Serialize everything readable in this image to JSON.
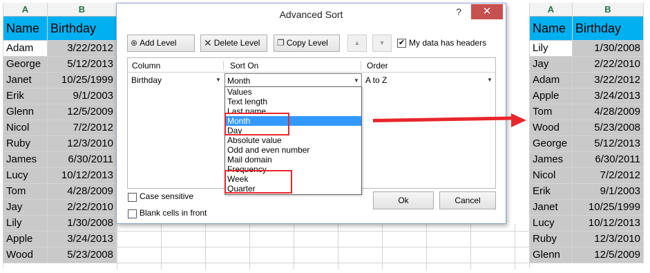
{
  "left_sheet": {
    "col_headers": [
      "A",
      "B"
    ],
    "header_row": [
      "Name",
      "Birthday"
    ],
    "rows": [
      [
        "Adam",
        "3/22/2012"
      ],
      [
        "George",
        "5/12/2013"
      ],
      [
        "Janet",
        "10/25/1999"
      ],
      [
        "Erik",
        "9/1/2003"
      ],
      [
        "Glenn",
        "12/5/2009"
      ],
      [
        "Nicol",
        "7/2/2012"
      ],
      [
        "Ruby",
        "12/3/2010"
      ],
      [
        "James",
        "6/30/2011"
      ],
      [
        "Lucy",
        "10/12/2013"
      ],
      [
        "Tom",
        "4/28/2009"
      ],
      [
        "Jay",
        "2/22/2010"
      ],
      [
        "Lily",
        "1/30/2008"
      ],
      [
        "Apple",
        "3/24/2013"
      ],
      [
        "Wood",
        "5/23/2008"
      ]
    ]
  },
  "right_sheet": {
    "col_headers": [
      "A",
      "B"
    ],
    "header_row": [
      "Name",
      "Birthday"
    ],
    "rows": [
      [
        "Lily",
        "1/30/2008"
      ],
      [
        "Jay",
        "2/22/2010"
      ],
      [
        "Adam",
        "3/22/2012"
      ],
      [
        "Apple",
        "3/24/2013"
      ],
      [
        "Tom",
        "4/28/2009"
      ],
      [
        "Wood",
        "5/23/2008"
      ],
      [
        "George",
        "5/12/2013"
      ],
      [
        "James",
        "6/30/2011"
      ],
      [
        "Nicol",
        "7/2/2012"
      ],
      [
        "Erik",
        "9/1/2003"
      ],
      [
        "Janet",
        "10/25/1999"
      ],
      [
        "Lucy",
        "10/12/2013"
      ],
      [
        "Ruby",
        "12/3/2010"
      ],
      [
        "Glenn",
        "12/5/2009"
      ]
    ]
  },
  "dialog": {
    "title": "Advanced Sort",
    "help": "?",
    "close": "✕",
    "toolbar": {
      "add_level": "Add Level",
      "delete_level": "Delete Level",
      "copy_level": "Copy Level",
      "move_up": "▲",
      "move_down": "▼",
      "headers_label": "My data has headers",
      "headers_checked": "✔"
    },
    "grid": {
      "col_column": "Column",
      "col_sort_on": "Sort On",
      "col_order": "Order",
      "column_value": "Birthday",
      "sort_on_value": "Month",
      "order_value": "A to Z"
    },
    "sort_on_options": [
      "Values",
      "Text length",
      "Last name",
      "Month",
      "Day",
      "Absolute value",
      "Odd and even number",
      "Mail domain",
      "Frequency",
      "Week",
      "Quarter"
    ],
    "selected_option": "Month",
    "case_sensitive": "Case sensitive",
    "blank_cells": "Blank cells in front",
    "ok": "Ok",
    "cancel": "Cancel"
  },
  "colors": {
    "header_fill": "#00b0f0",
    "selection_fill": "#c9c9c9",
    "highlight": "#e8262b",
    "list_selection": "#3399ff"
  }
}
